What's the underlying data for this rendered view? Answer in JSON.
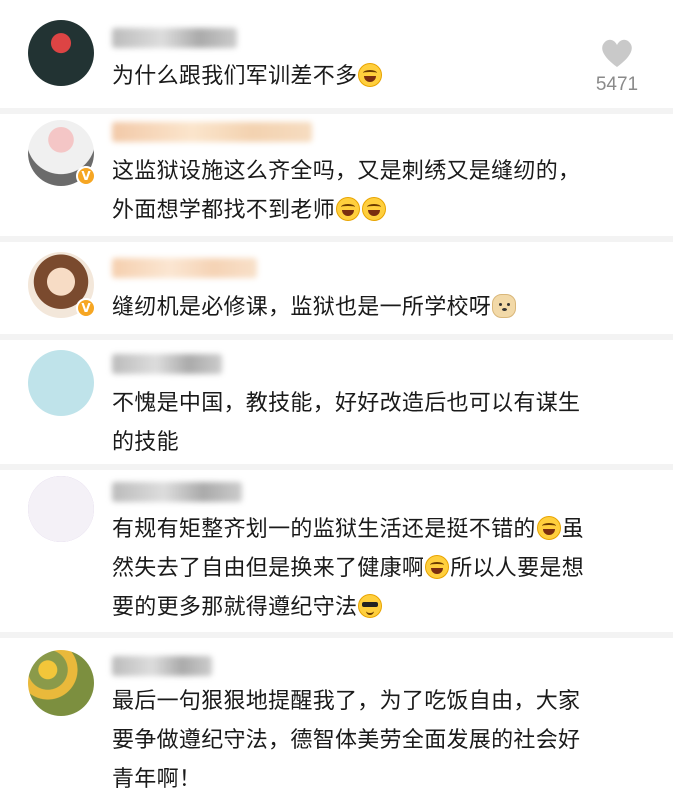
{
  "comments": [
    {
      "text": "为什么跟我们军训差不多",
      "emoji": "laugh-tears-emoji",
      "likes": "5471"
    },
    {
      "text_line1": "这监狱设施这么齐全吗，又是刺绣又是缝纫的，",
      "text_line2": "外面想学都找不到老师",
      "emoji": "laugh-emoji",
      "verified": "V"
    },
    {
      "text": "缝纫机是必修课，监狱也是一所学校呀",
      "emoji": "dog-emoji",
      "verified": "V"
    },
    {
      "text_line1": "不愧是中国，教技能，好好改造后也可以有谋生",
      "text_line2": "的技能"
    },
    {
      "part1": "有规有矩整齐划一的监狱生活还是挺不错的",
      "part2": "虽",
      "line2a": "然失去了自由但是换来了健康啊",
      "line2b": "所以人要是想",
      "line3": "要的更多那就得遵纪守法",
      "emoji1": "laugh-emoji",
      "emoji2": "laugh-emoji",
      "emoji3": "cool-emoji"
    },
    {
      "text_line1": "最后一句狠狠地提醒我了，为了吃饭自由，大家",
      "text_line2": "要争做遵纪守法，德智体美劳全面发展的社会好",
      "text_line3": "青年啊！"
    }
  ],
  "colors": {
    "text": "#1a1a1a",
    "like_count": "#8a8a8a",
    "verified_badge": "#f6a623",
    "divider": "#f3f3f3"
  }
}
